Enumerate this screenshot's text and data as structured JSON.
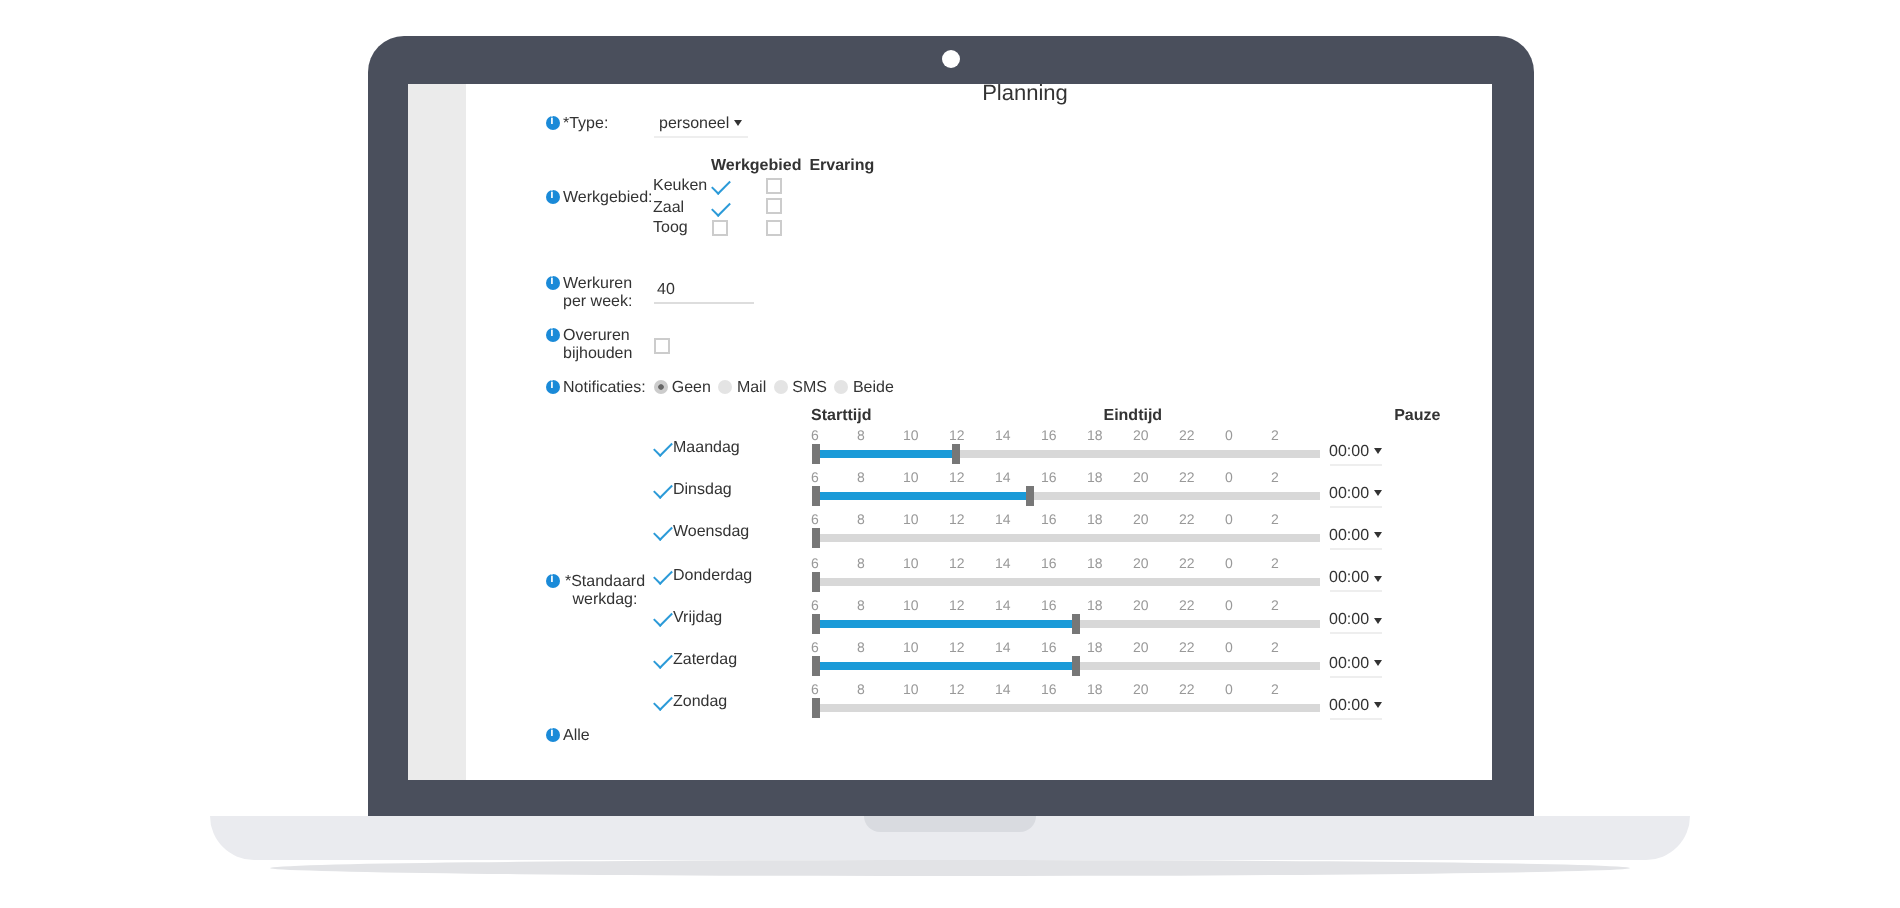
{
  "page_title": "Planning",
  "type_field": {
    "info": "i",
    "label": "*Type:",
    "value": "personeel"
  },
  "werkgebied": {
    "info": "i",
    "label": "Werkgebied:",
    "headers": [
      "Werkgebied",
      "Ervaring"
    ],
    "rows": [
      {
        "name": "Keuken",
        "werkgebied": true,
        "ervaring": false
      },
      {
        "name": "Zaal",
        "werkgebied": true,
        "ervaring": false
      },
      {
        "name": "Toog",
        "werkgebied": false,
        "ervaring": false
      }
    ]
  },
  "werkuren": {
    "info": "i",
    "label": "Werkuren per week:",
    "value": "40"
  },
  "overuren": {
    "info": "i",
    "label": "Overuren bijhouden",
    "checked": false
  },
  "notificaties": {
    "info": "i",
    "label": "Notificaties:",
    "options": [
      {
        "label": "Geen",
        "selected": true
      },
      {
        "label": "Mail",
        "selected": false
      },
      {
        "label": "SMS",
        "selected": false
      },
      {
        "label": "Beide",
        "selected": false
      }
    ]
  },
  "werkdag": {
    "info": "i",
    "label": "*Standaard werkdag:",
    "start_header": "Starttijd",
    "end_header": "Eindtijd",
    "pause_header": "Pauze",
    "days": [
      {
        "name": "Maandag",
        "checked": true,
        "ticks": [
          "6",
          "8",
          "10",
          "12",
          "14",
          "16",
          "18",
          "20",
          "22",
          "0",
          "2"
        ],
        "level": 0.28,
        "pause": "00:00"
      },
      {
        "name": "Dinsdag",
        "checked": true,
        "ticks": [
          "6",
          "8",
          "10",
          "12",
          "14",
          "16",
          "18",
          "20",
          "22",
          "0",
          "2"
        ],
        "level": 0.43,
        "pause": "00:00"
      },
      {
        "name": "Woensdag",
        "checked": true,
        "ticks": [
          "6",
          "8",
          "10",
          "12",
          "14",
          "16",
          "18",
          "20",
          "22",
          "0",
          "2"
        ],
        "level": 0,
        "pause": "00:00"
      },
      {
        "name": "Donderdag",
        "checked": true,
        "ticks": [
          "6",
          "8",
          "10",
          "12",
          "14",
          "16",
          "18",
          "20",
          "22",
          "0",
          "2"
        ],
        "level": 0,
        "pause": "00:00"
      },
      {
        "name": "Vrijdag",
        "checked": true,
        "ticks": [
          "6",
          "8",
          "10",
          "12",
          "14",
          "16",
          "18",
          "20",
          "22",
          "0",
          "2"
        ],
        "level": 0.52,
        "pause": "00:00"
      },
      {
        "name": "Zaterdag",
        "checked": true,
        "ticks": [
          "6",
          "8",
          "10",
          "12",
          "14",
          "16",
          "18",
          "20",
          "22",
          "0",
          "2"
        ],
        "level": 0.52,
        "pause": "00:00"
      },
      {
        "name": "Zondag",
        "checked": true,
        "ticks": [
          "6",
          "8",
          "10",
          "12",
          "14",
          "16",
          "18",
          "20",
          "22",
          "0",
          "2"
        ],
        "level": 0,
        "pause": "00:00"
      }
    ]
  },
  "alle": {
    "info": "i",
    "label": "Alle"
  }
}
